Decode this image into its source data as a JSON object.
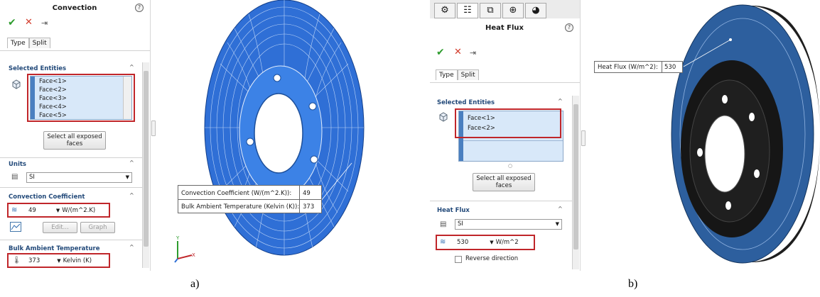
{
  "left_panel": {
    "title": "Convection",
    "help": "?",
    "ok_icon": "check-icon",
    "cancel_icon": "close-icon",
    "pin_icon": "pushpin-icon",
    "tabs": [
      "Type",
      "Split"
    ],
    "selected_entities": {
      "header": "Selected Entities",
      "items": [
        "Face<1>",
        "Face<2>",
        "Face<3>",
        "Face<4>",
        "Face<5>"
      ]
    },
    "select_all_button": "Select all exposed faces",
    "units": {
      "header": "Units",
      "value": "SI"
    },
    "convection_coefficient": {
      "header": "Convection Coefficient",
      "value": "49",
      "unit": "W/(m^2.K)"
    },
    "edit_button": "Edit...",
    "graph_button": "Graph",
    "bulk_temp": {
      "header": "Bulk Ambient Temperature",
      "value": "373",
      "unit": "Kelvin (K)"
    }
  },
  "left_callout": {
    "rows": [
      {
        "label": "Convection Coefficient (W/(m^2.K)):",
        "value": "49"
      },
      {
        "label": "Bulk Ambient Temperature (Kelvin (K)):",
        "value": "373"
      }
    ]
  },
  "right_panel": {
    "title": "Heat Flux",
    "help": "?",
    "tabs": [
      "Type",
      "Split"
    ],
    "selected_entities": {
      "header": "Selected Entities",
      "items": [
        "Face<1>",
        "Face<2>"
      ]
    },
    "select_all_button": "Select all exposed faces",
    "heat_flux": {
      "header": "Heat Flux",
      "units": "SI",
      "value": "530",
      "unit": "W/m^2"
    },
    "reverse_direction": "Reverse direction"
  },
  "right_callout": {
    "label": "Heat Flux (W/m^2):",
    "value": "530"
  },
  "captions": {
    "left": "a)",
    "right": "b)"
  },
  "colors": {
    "accent": "#2f6fd6",
    "highlight": "#c0262a",
    "disc_dark": "#141414",
    "disc_blue": "#2d5f9e"
  }
}
